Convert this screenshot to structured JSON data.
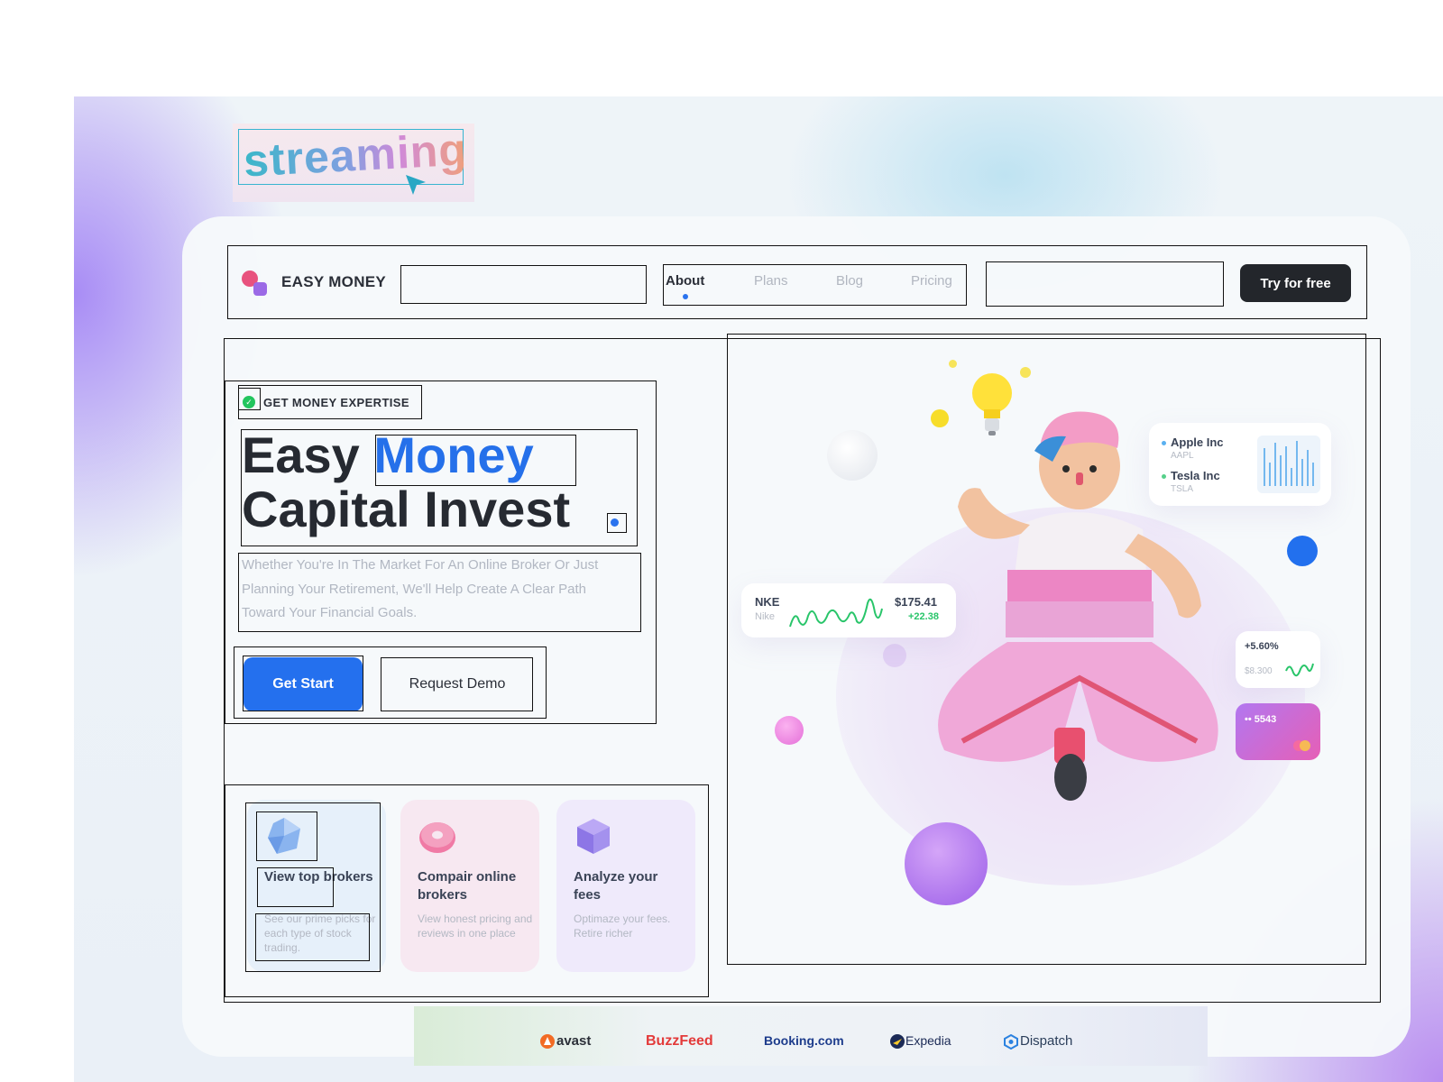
{
  "sticker": {
    "word": "streaming"
  },
  "header": {
    "brand": "EASY MONEY",
    "nav": [
      "About",
      "Plans",
      "Blog",
      "Pricing"
    ],
    "cta": "Try for free"
  },
  "hero": {
    "badge": "GET MONEY EXPERTISE",
    "headline_1": "Easy",
    "headline_accent": "Money",
    "headline_2": "Capital Invest",
    "description": "Whether You're In The Market For An Online Broker Or Just Planning Your Retirement, We'll Help Create A Clear Path Toward Your Financial Goals.",
    "primary_button": "Get Start",
    "secondary_button": "Request Demo"
  },
  "features": [
    {
      "title": "View top brokers",
      "desc": "See our prime picks for each type of stock trading.",
      "icon": "crystal-icon"
    },
    {
      "title": "Compair online brokers",
      "desc": "View honest pricing and reviews in one place",
      "icon": "donut-icon"
    },
    {
      "title": "Analyze your fees",
      "desc": "Optimaze your fees. Retire richer",
      "icon": "cube-icon"
    }
  ],
  "widgets": {
    "stocks": [
      {
        "name": "Apple Inc",
        "ticker": "AAPL"
      },
      {
        "name": "Tesla Inc",
        "ticker": "TSLA"
      }
    ],
    "nike": {
      "symbol": "NKE",
      "name": "Nike",
      "price": "$175.41",
      "change": "+22.38"
    },
    "growth": {
      "pct": "+5.60%",
      "amount": "$8.300"
    },
    "card": {
      "number": "•• 5543"
    }
  },
  "partners": [
    "avast",
    "BuzzFeed",
    "Booking.com",
    "Expedia",
    "Dispatch"
  ],
  "colors": {
    "accent": "#2470ee",
    "dark": "#23262b",
    "positive": "#22c55e",
    "brand_pink": "#e8527e"
  }
}
